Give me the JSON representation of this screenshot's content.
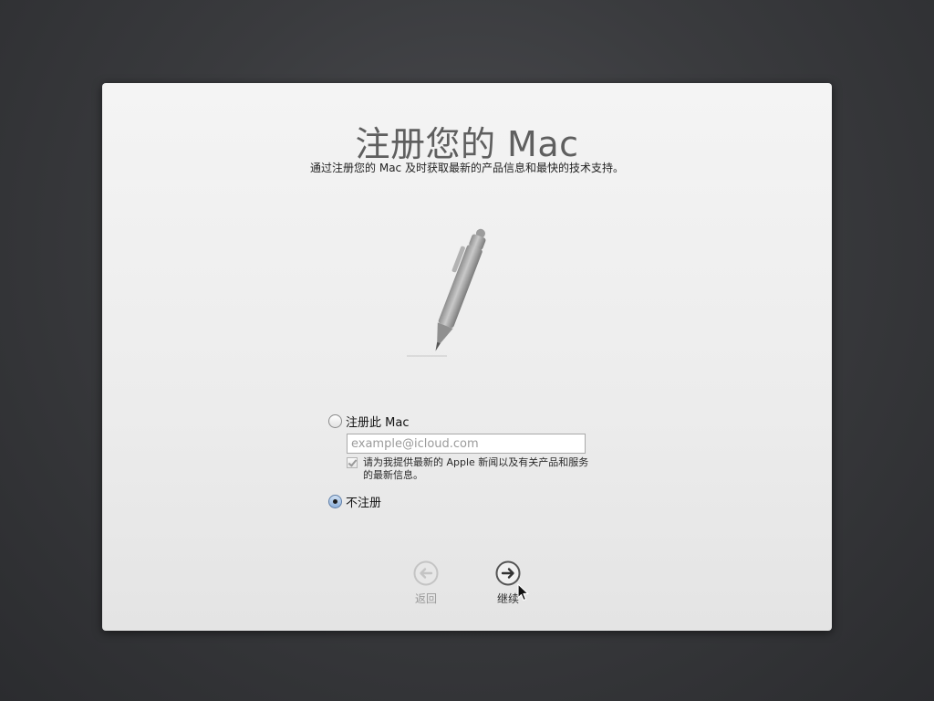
{
  "dialog": {
    "title": "注册您的 Mac",
    "subtitle": "通过注册您的 Mac 及时获取最新的产品信息和最快的技术支持。",
    "illustration": "pen-icon"
  },
  "options": {
    "register": {
      "label": "注册此 Mac",
      "selected": false,
      "email_placeholder": "example@icloud.com",
      "email_value": "",
      "newsletter_checked": true,
      "newsletter_line1": "请为我提供最新的 Apple 新闻以及有关产品和服务",
      "newsletter_line2": "的最新信息。"
    },
    "skip": {
      "label": "不注册",
      "selected": true
    }
  },
  "navigation": {
    "back_label": "返回",
    "back_icon": "arrow-left-circle-icon",
    "back_enabled": false,
    "continue_label": "继续",
    "continue_icon": "arrow-right-circle-icon",
    "continue_enabled": true
  },
  "colors": {
    "desktop_background": "#3a3b3e",
    "panel_background": "#ececec",
    "title_color": "#5f5f5f",
    "selected_radio": "#8fb1dc"
  }
}
